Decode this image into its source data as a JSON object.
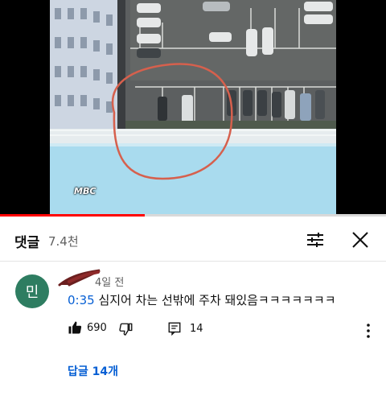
{
  "video": {
    "watermark": "MBC",
    "progress": 0.375
  },
  "header": {
    "title": "댓글",
    "count": "7.4천"
  },
  "comment": {
    "avatar_letter": "민",
    "time_ago": "4일 전",
    "timestamp": "0:35",
    "text": " 심지어 차는 선밖에 주차 돼있음ㅋㅋㅋㅋㅋㅋㅋ",
    "likes": "690",
    "reply_count": "14",
    "replies_label": "답글 14개"
  },
  "icons": [
    "sliders-icon",
    "close-icon",
    "thumbs-up-icon",
    "thumbs-down-icon",
    "reply-icon",
    "more-vert-icon",
    "chevron-down-icon"
  ],
  "colors": {
    "accent": "#065fd4",
    "progress": "#ff0000",
    "avatar": "#2e7d61"
  }
}
